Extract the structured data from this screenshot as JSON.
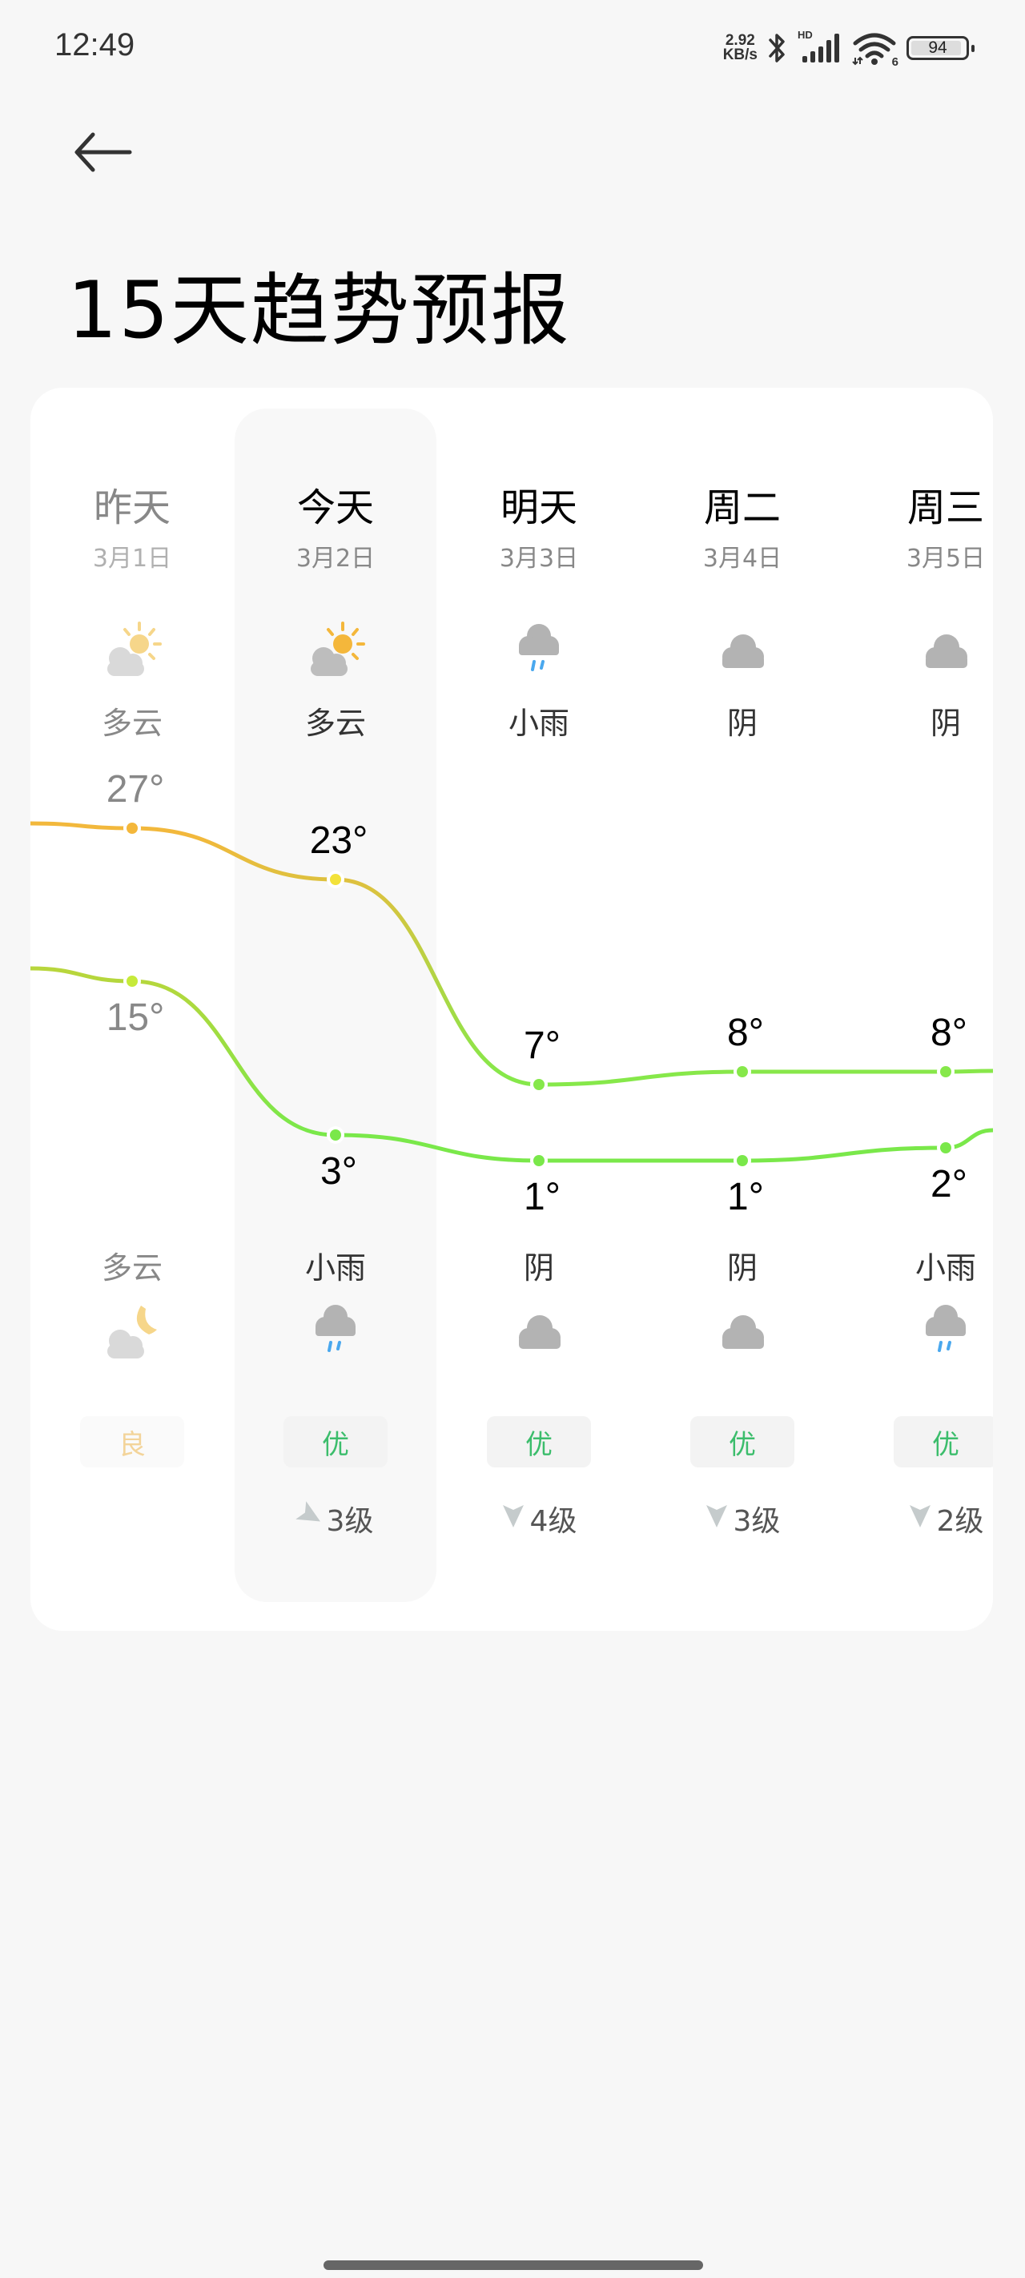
{
  "status_bar": {
    "time": "12:49",
    "net_speed_value": "2.92",
    "net_speed_unit": "KB/s",
    "signal_label": "HD",
    "wifi_label": "6",
    "battery": "94"
  },
  "header": {
    "back_icon": "arrow-left-icon",
    "title": "15天趋势预报"
  },
  "forecast": {
    "days": [
      {
        "name": "昨天",
        "date": "3月1日",
        "day_icon": "partly-cloudy-day-icon",
        "day_cond": "多云",
        "high": 27,
        "high_label": "27°",
        "low": 15,
        "low_label": "15°",
        "night_cond": "多云",
        "night_icon": "partly-cloudy-night-icon",
        "aqi": "良",
        "wind": "",
        "wind_dir": "",
        "past": true
      },
      {
        "name": "今天",
        "date": "3月2日",
        "day_icon": "partly-cloudy-day-icon",
        "day_cond": "多云",
        "high": 23,
        "high_label": "23°",
        "low": 3,
        "low_label": "3°",
        "night_cond": "小雨",
        "night_icon": "light-rain-icon",
        "aqi": "优",
        "wind": "3级",
        "wind_dir": "west",
        "past": false,
        "today": true
      },
      {
        "name": "明天",
        "date": "3月3日",
        "day_icon": "light-rain-icon",
        "day_cond": "小雨",
        "high": 7,
        "high_label": "7°",
        "low": 1,
        "low_label": "1°",
        "night_cond": "阴",
        "night_icon": "overcast-icon",
        "aqi": "优",
        "wind": "4级",
        "wind_dir": "south",
        "past": false
      },
      {
        "name": "周二",
        "date": "3月4日",
        "day_icon": "overcast-icon",
        "day_cond": "阴",
        "high": 8,
        "high_label": "8°",
        "low": 1,
        "low_label": "1°",
        "night_cond": "阴",
        "night_icon": "overcast-icon",
        "aqi": "优",
        "wind": "3级",
        "wind_dir": "south",
        "past": false
      },
      {
        "name": "周三",
        "date": "3月5日",
        "day_icon": "overcast-icon",
        "day_cond": "阴",
        "high": 8,
        "high_label": "8°",
        "low": 2,
        "low_label": "2°",
        "night_cond": "小雨",
        "night_icon": "light-rain-icon",
        "aqi": "优",
        "wind": "2级",
        "wind_dir": "south",
        "past": false
      }
    ]
  },
  "colors": {
    "high_line_warm": "#f2b83c",
    "high_line_cool": "#86e84a",
    "low_line": "#7ae84a",
    "aqi_good": "#3cbd6c",
    "aqi_moderate": "#f3d49a",
    "rain": "#4aa8ee"
  },
  "chart_data": {
    "type": "line",
    "categories": [
      "昨天",
      "今天",
      "明天",
      "周二",
      "周三"
    ],
    "series": [
      {
        "name": "high",
        "values": [
          27,
          23,
          7,
          8,
          8
        ]
      },
      {
        "name": "low",
        "values": [
          15,
          3,
          1,
          1,
          2
        ]
      }
    ],
    "title": "",
    "xlabel": "",
    "ylabel": "",
    "grid": false
  }
}
